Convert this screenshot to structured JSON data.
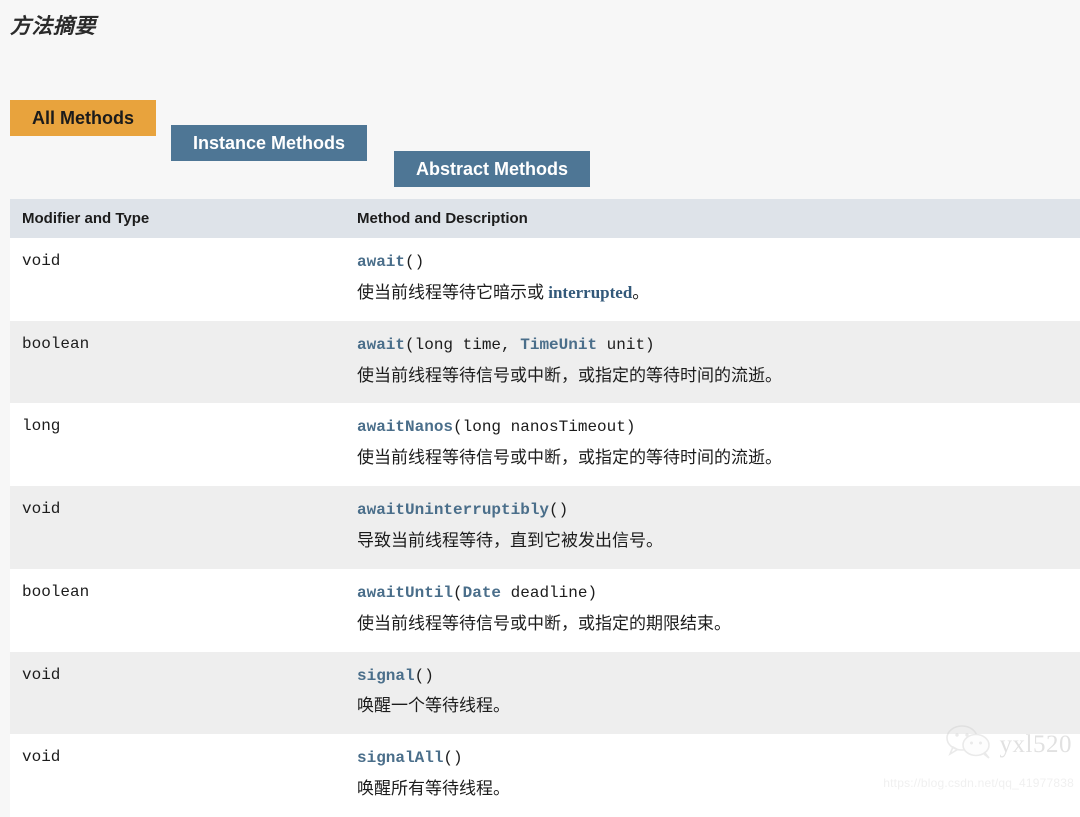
{
  "page": {
    "title": "方法摘要",
    "background_color": "#f7f7f7"
  },
  "tabs": {
    "active_color": "#e8a33d",
    "inactive_color": "#4e7695",
    "items": [
      {
        "label": "All Methods",
        "state": "active"
      },
      {
        "label": "Instance Methods",
        "state": "inactive"
      },
      {
        "label": "Abstract Methods",
        "state": "inactive"
      }
    ]
  },
  "table": {
    "header_background": "#dee3e9",
    "link_color": "#4a6e8a",
    "columns": [
      {
        "label": "Modifier and Type"
      },
      {
        "label": "Method and Description"
      }
    ],
    "rows": [
      {
        "type": "void",
        "method_name": "await",
        "signature_rest": "()",
        "sig_params": [],
        "description_pre": "使当前线程等待它暗示或 ",
        "description_link": "interrupted",
        "description_post": "。"
      },
      {
        "type": "boolean",
        "method_name": "await",
        "signature_rest": "(long time, TimeUnit unit)",
        "sig_params": [
          {
            "text": "(long time, ",
            "link": false
          },
          {
            "text": "TimeUnit",
            "link": true
          },
          {
            "text": " unit)",
            "link": false
          }
        ],
        "description_pre": "使当前线程等待信号或中断，或指定的等待时间的流逝。",
        "description_link": "",
        "description_post": ""
      },
      {
        "type": "long",
        "method_name": "awaitNanos",
        "signature_rest": "(long nanosTimeout)",
        "sig_params": [
          {
            "text": "(long nanosTimeout)",
            "link": false
          }
        ],
        "description_pre": "使当前线程等待信号或中断，或指定的等待时间的流逝。",
        "description_link": "",
        "description_post": ""
      },
      {
        "type": "void",
        "method_name": "awaitUninterruptibly",
        "signature_rest": "()",
        "sig_params": [
          {
            "text": "()",
            "link": false
          }
        ],
        "description_pre": "导致当前线程等待，直到它被发出信号。",
        "description_link": "",
        "description_post": ""
      },
      {
        "type": "boolean",
        "method_name": "awaitUntil",
        "signature_rest": "(Date deadline)",
        "sig_params": [
          {
            "text": "(",
            "link": false
          },
          {
            "text": "Date",
            "link": true
          },
          {
            "text": " deadline)",
            "link": false
          }
        ],
        "description_pre": "使当前线程等待信号或中断，或指定的期限结束。",
        "description_link": "",
        "description_post": ""
      },
      {
        "type": "void",
        "method_name": "signal",
        "signature_rest": "()",
        "sig_params": [
          {
            "text": "()",
            "link": false
          }
        ],
        "description_pre": "唤醒一个等待线程。",
        "description_link": "",
        "description_post": ""
      },
      {
        "type": "void",
        "method_name": "signalAll",
        "signature_rest": "()",
        "sig_params": [
          {
            "text": "()",
            "link": false
          }
        ],
        "description_pre": "唤醒所有等待线程。",
        "description_link": "",
        "description_post": ""
      }
    ]
  },
  "watermark": {
    "name": "yxl520",
    "url": "https://blog.csdn.net/qq_41977838"
  }
}
